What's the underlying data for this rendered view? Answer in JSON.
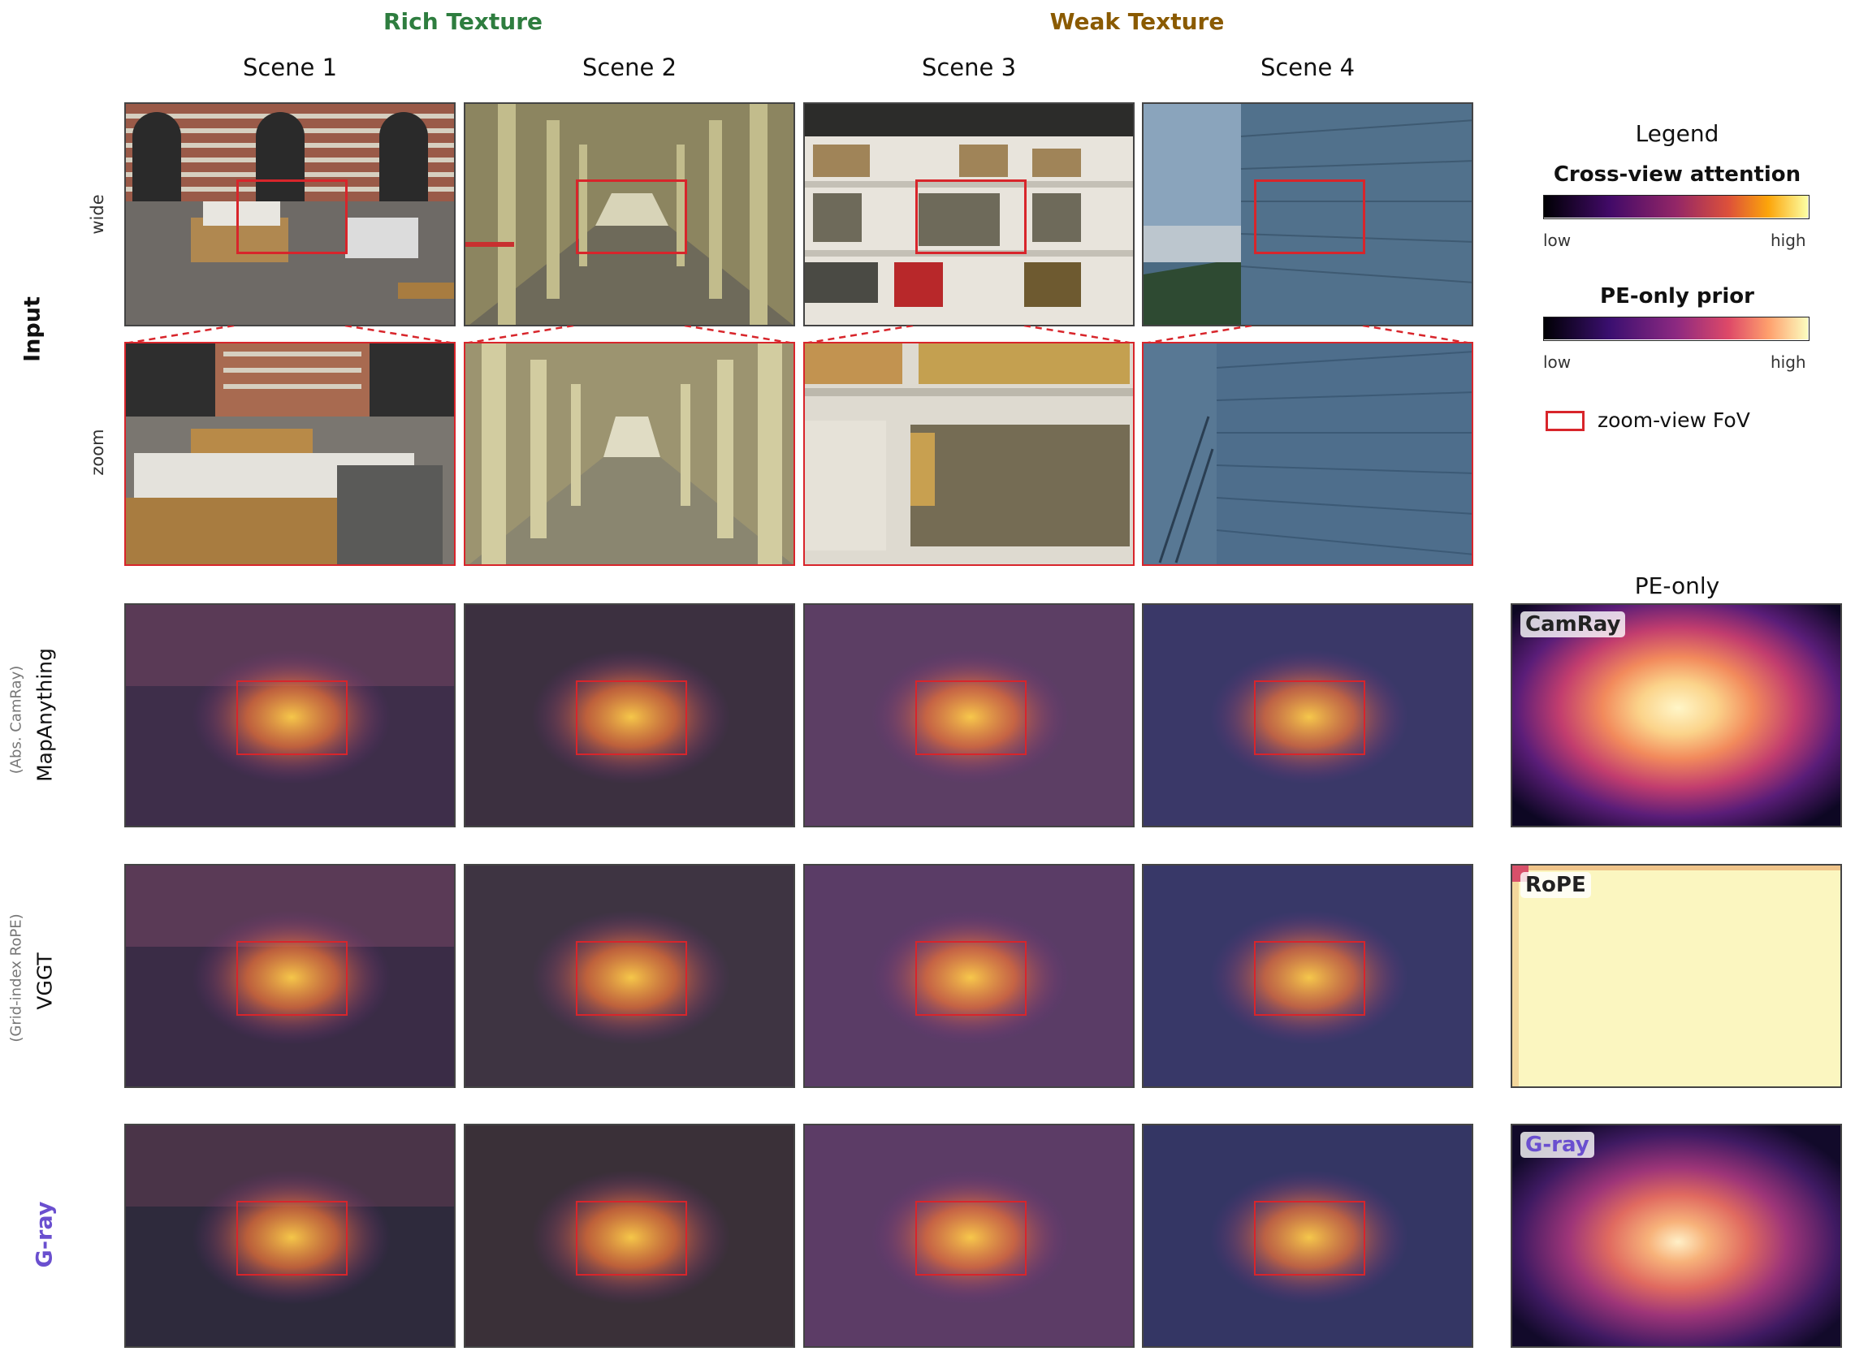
{
  "groups": {
    "rich": "Rich Texture",
    "weak": "Weak Texture"
  },
  "scenes": [
    "Scene 1",
    "Scene 2",
    "Scene 3",
    "Scene 4"
  ],
  "rows": {
    "input": "Input",
    "wide": "wide",
    "zoom": "zoom",
    "mapanything_sub": "(Abs. CamRay)",
    "mapanything": "MapAnything",
    "vggt_sub": "(Grid-index RoPE)",
    "vggt": "VGGT",
    "gray": "G-ray"
  },
  "legend": {
    "title": "Legend",
    "cross_view": "Cross-view attention",
    "pe_prior": "PE-only prior",
    "low": "low",
    "high": "high",
    "fov": "zoom-view FoV"
  },
  "pe_only": {
    "title": "PE-only",
    "camray": "CamRay",
    "rope": "RoPE",
    "gray": "G-ray"
  },
  "colors": {
    "rich": "#2e7d3f",
    "weak": "#8a5a00",
    "gray": "#6a4fcf",
    "fov_box": "#d8252b"
  }
}
